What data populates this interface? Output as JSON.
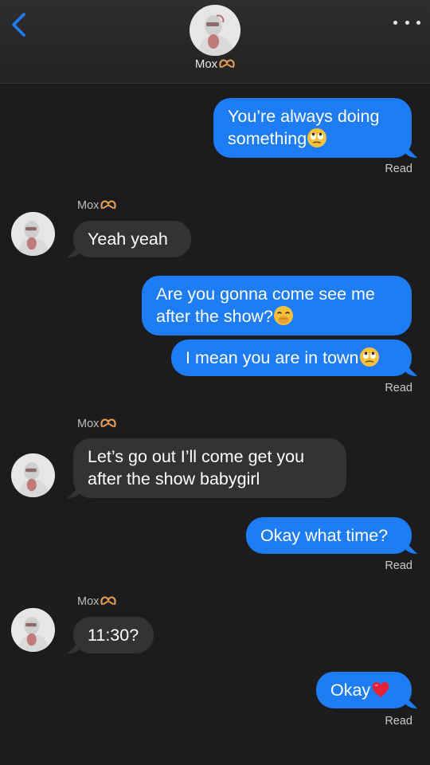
{
  "contact": {
    "name": "Mox"
  },
  "messages": {
    "m1": {
      "text": "You’re always doing something",
      "line1": "You’re always doing",
      "line2": "something"
    },
    "read1": "Read",
    "sender1": "Mox",
    "m2": {
      "text": "Yeah yeah"
    },
    "m3": {
      "line1": "Are you gonna come see me",
      "line2": "after the show?"
    },
    "m4": {
      "text": "I mean you are in town"
    },
    "read2": "Read",
    "sender2": "Mox",
    "m5": {
      "line1": "Let’s go out I’ll come get you",
      "line2": "after the show babygirl"
    },
    "m6": {
      "text": "Okay what time?"
    },
    "read3": "Read",
    "sender3": "Mox",
    "m7": {
      "text": "11:30?"
    },
    "m8": {
      "text": "Okay"
    },
    "read4": "Read"
  },
  "icons": {
    "back": "chevron-left-icon",
    "more": "ellipsis-icon",
    "eye_roll": "eye-roll-emoji",
    "hand_over_mouth": "hand-over-mouth-emoji",
    "heart": "red-heart-emoji",
    "heart_hands": "heart-hands-emoji"
  },
  "colors": {
    "accent": "#1e7cf5",
    "received_bubble": "#333336",
    "background": "#1c1c1e"
  }
}
